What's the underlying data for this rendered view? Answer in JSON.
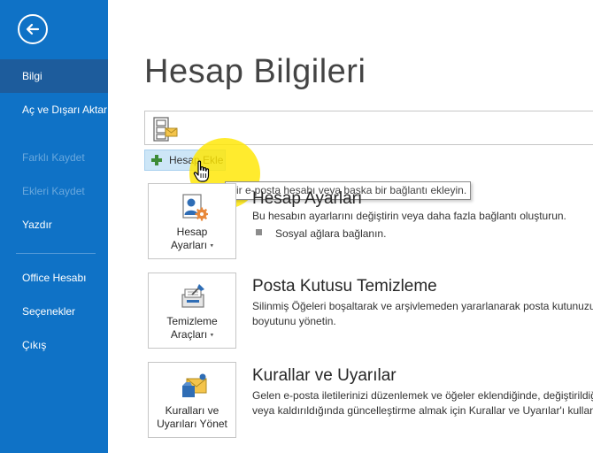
{
  "nav": {
    "items": [
      {
        "label": "Bilgi",
        "state": "active"
      },
      {
        "label": "Aç ve Dışarı Aktar",
        "state": "enabled"
      },
      {
        "label": "Farklı Kaydet",
        "state": "disabled"
      },
      {
        "label": "Ekleri Kaydet",
        "state": "disabled"
      },
      {
        "label": "Yazdır",
        "state": "enabled"
      },
      {
        "label": "Office Hesabı",
        "state": "enabled"
      },
      {
        "label": "Seçenekler",
        "state": "enabled"
      },
      {
        "label": "Çıkış",
        "state": "enabled"
      }
    ],
    "back_icon": "back-arrow-circle-icon"
  },
  "main": {
    "title": "Hesap Bilgileri",
    "account_selector_icon": "mailbox-icon",
    "add_account_label": "Hesap Ekle",
    "add_account_tooltip": "Bir e-posta hesabı veya başka bir bağlantı ekleyin.",
    "sections": [
      {
        "tile_label_line1": "Hesap",
        "tile_label_line2": "Ayarları",
        "icon": "account-settings-icon",
        "title": "Hesap Ayarları",
        "desc_line1": "Bu hesabın ayarlarını değiştirin veya daha fazla bağlantı oluşturun.",
        "bullet": "Sosyal ağlara bağlanın."
      },
      {
        "tile_label_line1": "Temizleme",
        "tile_label_line2": "Araçları",
        "icon": "cleanup-tools-icon",
        "title": "Posta Kutusu Temizleme",
        "desc_line1": "Silinmiş Öğeleri boşaltarak ve arşivlemeden yararlanarak posta kutunuzun",
        "desc_line2": "boyutunu yönetin."
      },
      {
        "tile_label_line1": "Kuralları ve",
        "tile_label_line2": "Uyarıları Yönet",
        "icon": "rules-alerts-icon",
        "title": "Kurallar ve Uyarılar",
        "desc_line1": "Gelen e-posta iletilerinizi düzenlemek ve öğeler eklendiğinde, değiştirildiğ",
        "desc_line2": "veya kaldırıldığında güncelleştirme almak için Kurallar ve Uyarılar'ı kullanı"
      }
    ]
  },
  "colors": {
    "nav_bg": "#0f72c6",
    "nav_active": "#1d5c9c",
    "highlight": "#ffe600",
    "button_bg": "#cde6f7"
  }
}
